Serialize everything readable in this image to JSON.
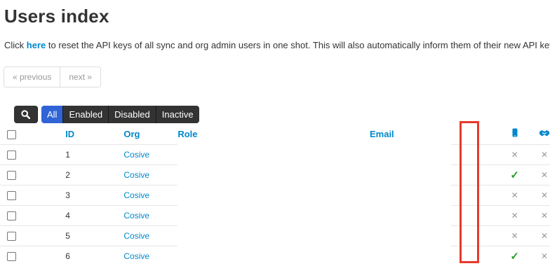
{
  "page": {
    "title": "Users index",
    "intro_before": "Click ",
    "intro_link": "here",
    "intro_after": " to reset the API keys of all sync and org admin users in one shot. This will also automatically inform them of their new API keys."
  },
  "pagination": {
    "previous": "« previous",
    "next": "next »"
  },
  "filters": {
    "search_icon": "magnifier-icon",
    "options": [
      "All",
      "Enabled",
      "Disabled",
      "Inactive"
    ],
    "selected": "All"
  },
  "table": {
    "columns": {
      "id": "ID",
      "org": "Org",
      "role": "Role",
      "email": "Email"
    },
    "column_icons": {
      "col1": "phone-icon",
      "col2": "handshake-icon"
    },
    "rows": [
      {
        "id": "1",
        "org": "Cosive",
        "phone": "cross",
        "sync": "cross"
      },
      {
        "id": "2",
        "org": "Cosive",
        "phone": "check",
        "sync": "cross"
      },
      {
        "id": "3",
        "org": "Cosive",
        "phone": "cross",
        "sync": "cross"
      },
      {
        "id": "4",
        "org": "Cosive",
        "phone": "cross",
        "sync": "cross"
      },
      {
        "id": "5",
        "org": "Cosive",
        "phone": "cross",
        "sync": "cross"
      },
      {
        "id": "6",
        "org": "Cosive",
        "phone": "check",
        "sync": "cross"
      }
    ]
  },
  "colors": {
    "link": "#0088cc",
    "filter_selected": "#2f63d6",
    "filter_bg": "#333333",
    "highlight_box": "#e8392b",
    "check": "#2b9b2b",
    "cross": "#9a9a9a"
  },
  "symbols": {
    "check": "✓",
    "cross": "✕"
  }
}
